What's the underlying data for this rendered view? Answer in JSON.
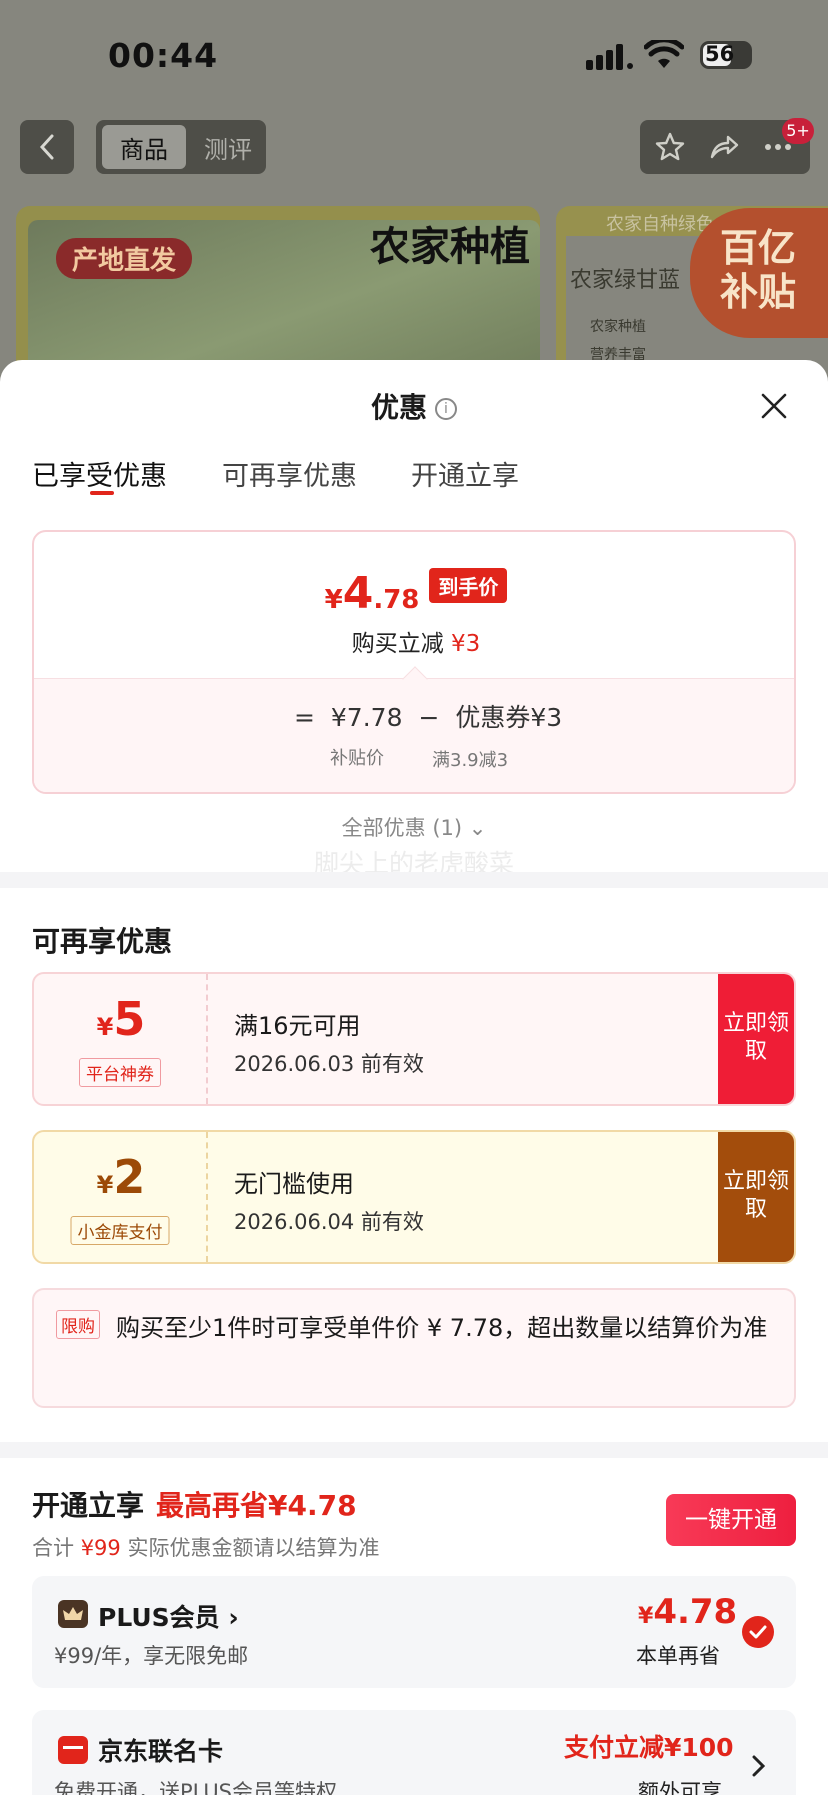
{
  "status_bar": {
    "time": "00:44",
    "battery": "56"
  },
  "nav": {
    "tab_product": "商品",
    "tab_review": "测评",
    "badge": "5+"
  },
  "banner": {
    "title": "农家种植",
    "tag": "产地直发",
    "right_top": "农家自种绿色",
    "right_name": "农家绿甘蓝",
    "right_line1": "农家种植",
    "right_line2": "营养丰富",
    "subsidy_line1": "百亿",
    "subsidy_line2": "补贴"
  },
  "sheet": {
    "title": "优惠",
    "tabs": [
      "已享受优惠",
      "可再享优惠",
      "开通立享"
    ],
    "price_card": {
      "currency": "¥",
      "price_int": "4",
      "price_dec": ".78",
      "final_tag": "到手价",
      "reduce_label": "购买立减",
      "reduce_amount": "¥3",
      "eq": "=",
      "base_price": "¥7.78",
      "minus": "−",
      "coupon_part": "优惠券¥3",
      "base_label": "补贴价",
      "coupon_label": "满3.9减3"
    },
    "all_discounts": "全部优惠 (1)",
    "watermark": "脚尖上的老虎酸菜"
  },
  "more": {
    "title": "可再享优惠",
    "coupons": [
      {
        "currency": "¥",
        "amount": "5",
        "tag": "平台神券",
        "condition": "满16元可用",
        "valid": "2026.06.03 前有效",
        "claim": "立即领取"
      },
      {
        "currency": "¥",
        "amount": "2",
        "tag": "小金库支付",
        "condition": "无门槛使用",
        "valid": "2026.06.04 前有效",
        "claim": "立即领取"
      }
    ],
    "limit_tag": "限购",
    "limit_text": "购买至少1件时可享受单件价 ¥ 7.78，超出数量以结算价为准"
  },
  "open": {
    "title": "开通立享",
    "save": "最高再省¥4.78",
    "sub_prefix": "合计",
    "sub_amount": "¥99",
    "sub_suffix": "实际优惠金额请以结算为准",
    "button": "一键开通",
    "plus": {
      "name": "PLUS会员 ›",
      "desc": "¥99/年，享无限免邮",
      "currency": "¥",
      "amount": "4.78",
      "note": "本单再省"
    },
    "card": {
      "name": "京东联名卡",
      "desc": "免费开通，送PLUS会员等特权",
      "amount": "支付立减¥100",
      "note": "额外可享"
    }
  },
  "colors": {
    "accent": "#e1251b",
    "gold": "#a34d0c",
    "sheet_bg": "#ffffff",
    "dim_bg": "#86867e"
  }
}
